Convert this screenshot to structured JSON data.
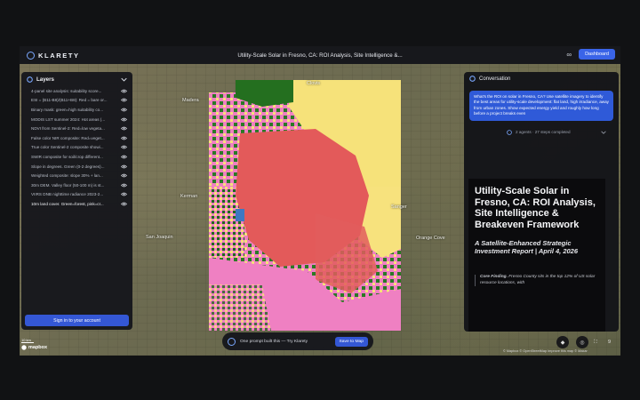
{
  "app": {
    "brand": "KLARETY",
    "title": "Utility-Scale Solar in Fresno, CA: ROI Analysis, Site Intelligence &...",
    "dashboard_label": "Dashboard"
  },
  "layers": {
    "title": "Layers",
    "items": [
      "4-panel site analysis: suitability score...",
      "ESI = (B11-B8)/(B11+B8): Red = bare or...",
      "Binary mask: green=high suitability co...",
      "MODIS LST summer 2024: Hot areas (...",
      "NDVI from Sentinel-2: Red=low vegeta...",
      "False color NIR composite: Red=veget...",
      "True color Sentinel-2 composite showi...",
      "SWIR composite for soil/crop different...",
      "Slope in degrees. Green (0-2 degrees)...",
      "Weighted composite: slope 30% + lan...",
      "30m DEM. Valley floor (50-100 m) is st...",
      "VIIRS DNB nighttime radiance 2023-2...",
      "10m land cover. Green=forest, pink=cr..."
    ],
    "signin_label": "Sign in to your account"
  },
  "conversation": {
    "title": "Conversation",
    "user_message": "What's the ROI on solar in Fresno, CA? Use satellite imagery to identify the best areas for utility-scale development: flat land, high irradiance, away from urban zones. Show expected energy yield and roughly how long before a project breaks even",
    "agents_summary": "2 agents · 27 steps completed",
    "report": {
      "title": "Utility-Scale Solar in Fresno, CA: ROI Analysis, Site Intelligence & Breakeven Framework",
      "subtitle": "A Satellite-Enhanced Strategic Investment Report | April 4, 2026",
      "finding_label": "Core Finding.",
      "finding_text": " Fresno County sits in the top 12% of US solar resource locations, with"
    }
  },
  "promptbar": {
    "text": "One prompt built this — Try Klarety",
    "save_label": "Save to Map"
  },
  "map": {
    "labels": {
      "a": "Madera",
      "b": "Fresno",
      "c": "Clovis",
      "d": "Sanger",
      "e": "Selma",
      "f": "Orange Cove",
      "g": "San Joaquin",
      "h": "Kerman"
    },
    "scale": "10 km",
    "brand": "mapbox",
    "attribution": "© Mapbox © OpenStreetMap Improve this map © Maxar",
    "zoom": "9"
  },
  "colors": {
    "accent": "#3457d5",
    "suit_high": "#f6e27a",
    "suit_mid": "#e35a5a",
    "suit_low": "#ef7fc0",
    "forest": "#1f6b1c"
  }
}
